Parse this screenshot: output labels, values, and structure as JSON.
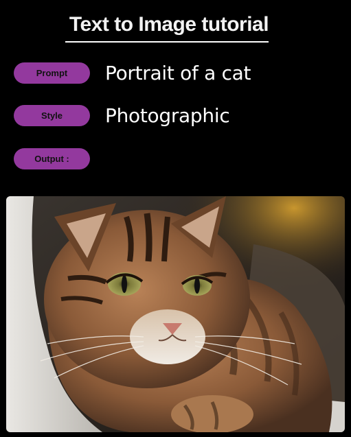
{
  "header": {
    "title": "Text to Image tutorial"
  },
  "fields": [
    {
      "label": "Prompt",
      "value": "Portrait of a cat"
    },
    {
      "label": "Style",
      "value": "Photographic"
    },
    {
      "label": "Output :",
      "value": ""
    }
  ],
  "colors": {
    "background": "#000000",
    "pill": "#93399e",
    "title": "#f2f2f2"
  },
  "output": {
    "image_subject": "tabby-cat-photo"
  }
}
